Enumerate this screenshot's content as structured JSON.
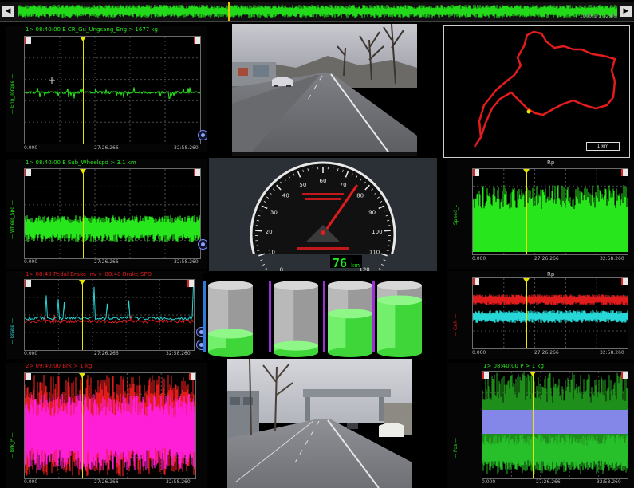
{
  "top_strip": {
    "right_label": "1000/1/1 12:00"
  },
  "panels": {
    "p1": {
      "title": "1> 08:40:00 E CR_Gu_Ungsang_Eng > 1677 kg",
      "t0": "0.000",
      "tmid": "27:26.266",
      "t1": "32:58.260",
      "color": "#27e61c"
    },
    "p2": {
      "title": "1> 08:40:00 E Sub_Wheelspd > 3.1 km",
      "t0": "0.000",
      "tmid": "27:26.266",
      "t1": "32:58.260",
      "color": "#27e61c",
      "head": ""
    },
    "p3": {
      "title": "1> 08:40 Pedal Brake Inv > 08:40 Brake SPD",
      "t0": "0.000",
      "tmid": "27:26.266",
      "t1": "32:58.260"
    },
    "p4": {
      "title": "2> 09:40:00 Brk > 1 kg",
      "t0": "0.000",
      "tmid": "27:26.266",
      "t1": "32:58.260",
      "head": ""
    },
    "p5": {
      "title": "",
      "head": "Rp",
      "t0": "0.000",
      "tmid": "27:26.266",
      "t1": "32:58.260",
      "ylabel": "Speed_L"
    },
    "p6": {
      "head": "Rp",
      "t0": "0.000",
      "tmid": "27:26.266",
      "t1": "32:58.260"
    },
    "p7": {
      "title": "1> 08:40:00 P > 1 kg",
      "t0": "0.000",
      "tmid": "27:26.266",
      "t1": "32:58.260"
    }
  },
  "gauge": {
    "ticks": [
      "0",
      "10",
      "20",
      "30",
      "40",
      "50",
      "60",
      "70",
      "80",
      "90",
      "100",
      "110",
      "120"
    ],
    "readout": "76",
    "unit": "km",
    "value": 76,
    "max": 120
  },
  "tanks": {
    "levels": [
      0.28,
      0.1,
      0.58,
      0.78
    ]
  },
  "map": {
    "scale_label": "1 km"
  }
}
